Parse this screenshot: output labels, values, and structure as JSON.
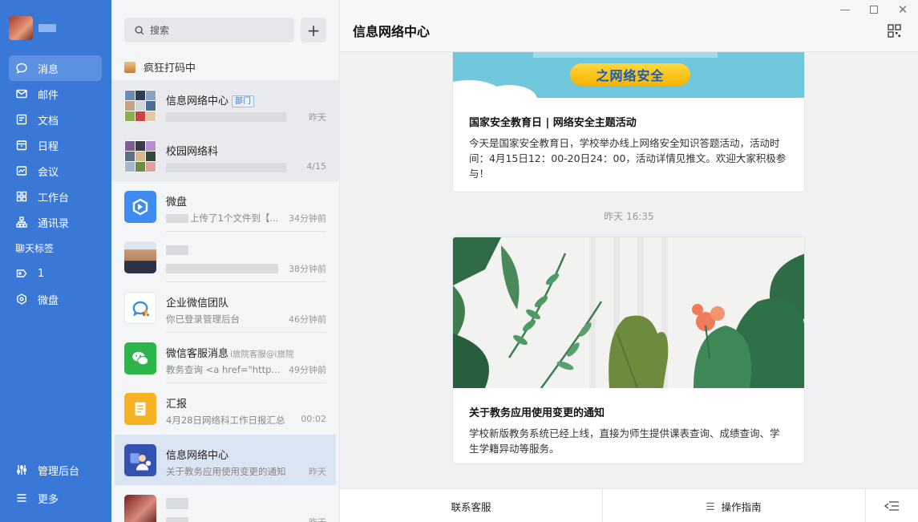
{
  "nav": {
    "items": [
      {
        "label": "消息",
        "icon": "chat-bubble-icon"
      },
      {
        "label": "邮件",
        "icon": "mail-icon"
      },
      {
        "label": "文档",
        "icon": "document-icon"
      },
      {
        "label": "日程",
        "icon": "calendar-icon"
      },
      {
        "label": "会议",
        "icon": "meeting-icon"
      },
      {
        "label": "工作台",
        "icon": "grid-icon"
      },
      {
        "label": "通讯录",
        "icon": "contacts-icon"
      }
    ],
    "section_label": "聊天标签",
    "tag_items": [
      {
        "label": "1",
        "icon": "tag-icon"
      },
      {
        "label": "微盘",
        "icon": "hexagon-icon"
      }
    ],
    "bottom_items": [
      {
        "label": "管理后台",
        "icon": "sliders-icon"
      },
      {
        "label": "更多",
        "icon": "menu-icon"
      }
    ]
  },
  "list": {
    "search_placeholder": "搜索",
    "status": "疯狂打码中",
    "conversations": [
      {
        "title": "信息网络中心",
        "badge": "部门",
        "subtitle": "",
        "time": "昨天"
      },
      {
        "title": "校园网络科",
        "subtitle": "",
        "time": "4/15"
      },
      {
        "title": "微盘",
        "subtitle": "上传了1个文件到【...",
        "time": "34分钟前"
      },
      {
        "title": "",
        "subtitle": "",
        "time": "38分钟前"
      },
      {
        "title": "企业微信团队",
        "subtitle": "你已登录管理后台",
        "time": "46分钟前"
      },
      {
        "title": "微信客服消息",
        "extra": "i旅院客服@i旅院",
        "subtitle": "教务查询 <a href=\"http...",
        "time": "49分钟前"
      },
      {
        "title": "汇报",
        "subtitle": "4月28日网络科工作日报汇总",
        "time": "00:02"
      },
      {
        "title": "信息网络中心",
        "subtitle": "关于教务应用使用变更的通知",
        "time": "昨天"
      },
      {
        "title": "",
        "subtitle": "",
        "time": "昨天"
      }
    ]
  },
  "main": {
    "title": "信息网络中心",
    "card1": {
      "banner_text": "之网络安全",
      "title": "国家安全教育日 | 网络安全主题活动",
      "desc": "今天是国家安全教育日，学校举办线上网络安全知识答题活动，活动时间：4月15日12：00-20日24：00，活动详情见推文。欢迎大家积极参与！"
    },
    "timestamp": "昨天 16:35",
    "card2": {
      "title": "关于教务应用使用变更的通知",
      "desc": "学校新版教务系统已经上线，直接为师生提供课表查询、成绩查询、学生学籍异动等服务。"
    },
    "footer": {
      "left": "联系客服",
      "right": "操作指南"
    }
  }
}
